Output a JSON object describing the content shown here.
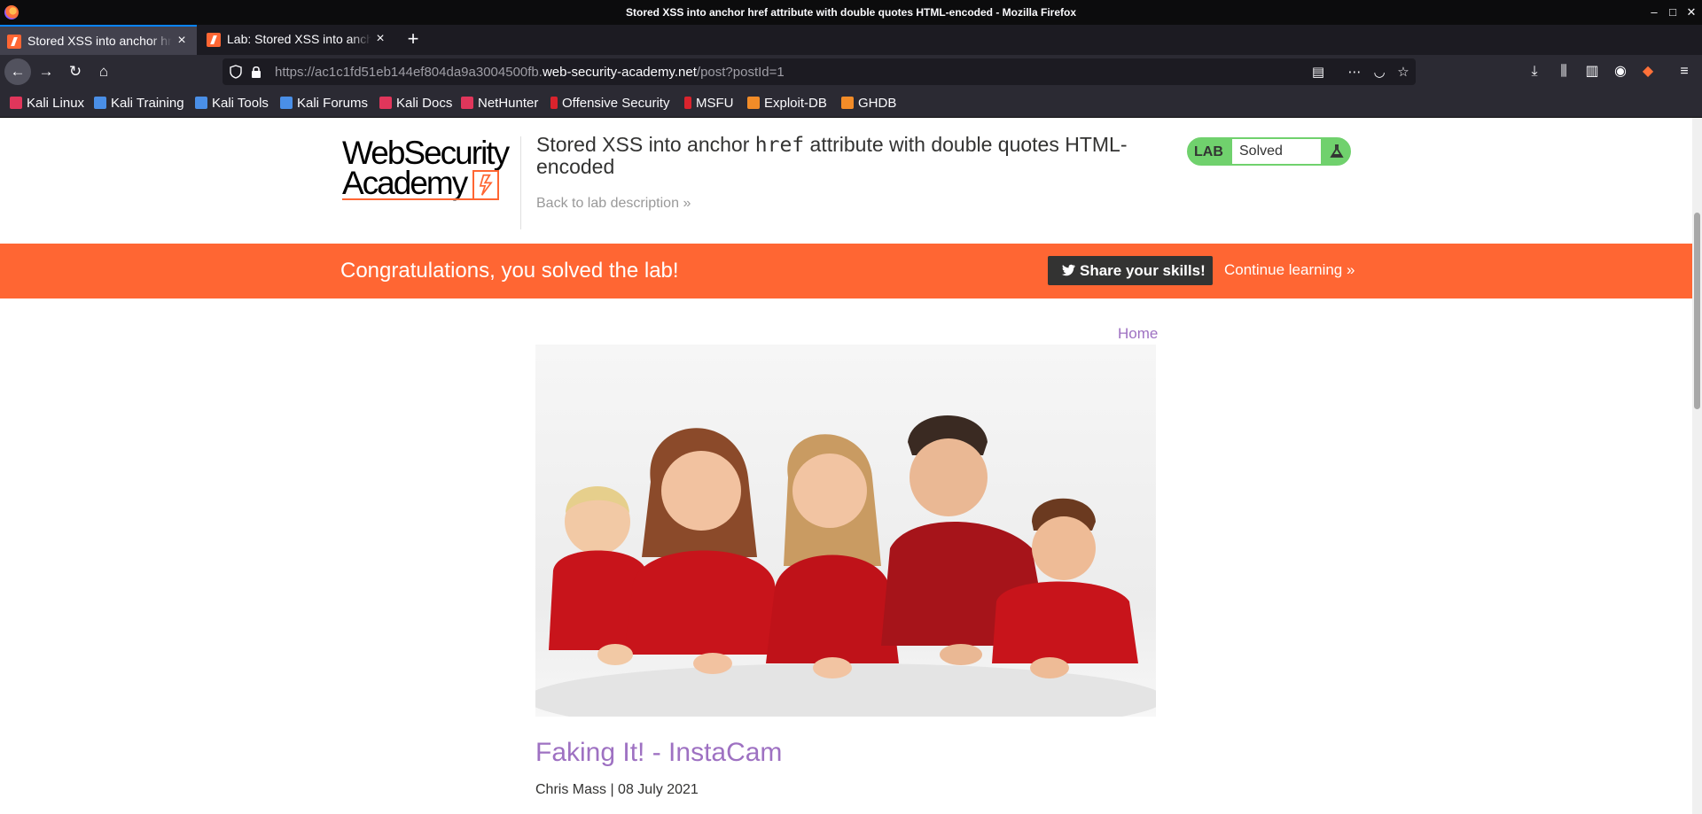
{
  "window": {
    "title": "Stored XSS into anchor href attribute with double quotes HTML-encoded - Mozilla Firefox"
  },
  "tabs": [
    {
      "label": "Stored XSS into anchor href attribute with double quotes HTML-encoded",
      "active": true
    },
    {
      "label": "Lab: Stored XSS into anchor href attribute with double quotes HTML-encoded",
      "active": false
    }
  ],
  "url": {
    "scheme_prefix": "https://ac1c1fd51eb144ef804da9a3004500fb.",
    "host": "web-security-academy.net",
    "path": "/post?postId=1"
  },
  "bookmarks": [
    {
      "label": "Kali Linux",
      "icon": "kali-dragon-icon",
      "color": "#e0365b"
    },
    {
      "label": "Kali Training",
      "icon": "kali-training-icon",
      "color": "#4a8fe7"
    },
    {
      "label": "Kali Tools",
      "icon": "kali-tools-icon",
      "color": "#4a8fe7"
    },
    {
      "label": "Kali Forums",
      "icon": "kali-forums-icon",
      "color": "#4a8fe7"
    },
    {
      "label": "Kali Docs",
      "icon": "kali-docs-icon",
      "color": "#e0365b"
    },
    {
      "label": "NetHunter",
      "icon": "nethunter-icon",
      "color": "#e0365b"
    },
    {
      "label": "Offensive Security",
      "icon": "offsec-icon",
      "color": "#d9232d"
    },
    {
      "label": "MSFU",
      "icon": "msfu-icon",
      "color": "#d9232d"
    },
    {
      "label": "Exploit-DB",
      "icon": "exploit-db-icon",
      "color": "#f28c28"
    },
    {
      "label": "GHDB",
      "icon": "ghdb-icon",
      "color": "#f28c28"
    }
  ],
  "lab": {
    "logo_line1": "WebSecurity",
    "logo_line2": "Academy",
    "title_before": "Stored XSS into anchor ",
    "title_code": "href",
    "title_after": " attribute with double quotes HTML-encoded",
    "back_link": "Back to lab description",
    "badge": "LAB",
    "status": "Solved",
    "status_color": "#70d16d"
  },
  "banner": {
    "message": "Congratulations, you solved the lab!",
    "share": "Share your skills!",
    "continue": "Continue learning",
    "color": "#ff6633"
  },
  "post": {
    "home": "Home",
    "title": "Faking It! - InstaCam",
    "meta": "Chris Mass | 08 July 2021",
    "image_description_icon": "family-photo"
  }
}
